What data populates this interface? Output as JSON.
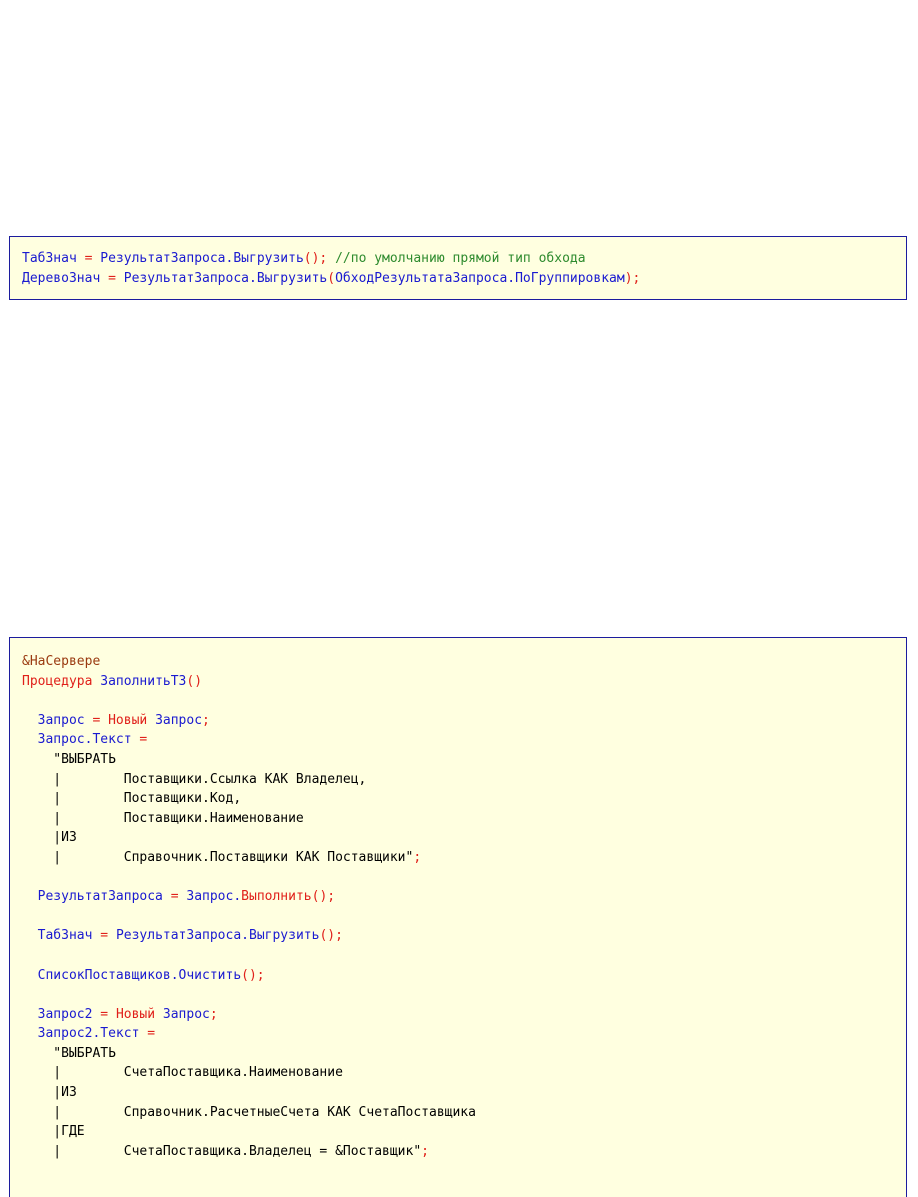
{
  "colors": {
    "identifier": "#1a1ad0",
    "keyword": "#e0201a",
    "operator": "#e0201a",
    "preprocessor": "#9a3a10",
    "comment": "#2e8b2e",
    "string": "#000000",
    "block_background": "#ffffe0",
    "block_border": "#1c1c9e"
  },
  "block1": {
    "lines": [
      [
        {
          "t": "ТабЗнач",
          "c": "id"
        },
        {
          "t": " = ",
          "c": "op"
        },
        {
          "t": "РезультатЗапроса.Выгрузить",
          "c": "id"
        },
        {
          "t": "(); ",
          "c": "op"
        },
        {
          "t": "//по умолчанию прямой тип обхода",
          "c": "cm"
        }
      ],
      [
        {
          "t": "ДеревоЗнач",
          "c": "id"
        },
        {
          "t": " = ",
          "c": "op"
        },
        {
          "t": "РезультатЗапроса.Выгрузить",
          "c": "id"
        },
        {
          "t": "(",
          "c": "op"
        },
        {
          "t": "ОбходРезультатаЗапроса.ПоГруппировкам",
          "c": "id"
        },
        {
          "t": ");",
          "c": "op"
        }
      ]
    ]
  },
  "block2": {
    "lines": [
      [
        {
          "t": "&НаСервере",
          "c": "pp"
        }
      ],
      [
        {
          "t": "Процедура ",
          "c": "kw"
        },
        {
          "t": "ЗаполнитьТЗ",
          "c": "id"
        },
        {
          "t": "()",
          "c": "op"
        }
      ],
      [],
      [
        {
          "t": "  Запрос",
          "c": "id"
        },
        {
          "t": " = ",
          "c": "op"
        },
        {
          "t": "Новый ",
          "c": "kw"
        },
        {
          "t": "Запрос",
          "c": "id"
        },
        {
          "t": ";",
          "c": "op"
        }
      ],
      [
        {
          "t": "  Запрос.Текст",
          "c": "id"
        },
        {
          "t": " =",
          "c": "op"
        }
      ],
      [
        {
          "t": "    \"ВЫБРАТЬ",
          "c": "str"
        }
      ],
      [
        {
          "t": "    |        Поставщики.Ссылка КАК Владелец,",
          "c": "str"
        }
      ],
      [
        {
          "t": "    |        Поставщики.Код,",
          "c": "str"
        }
      ],
      [
        {
          "t": "    |        Поставщики.Наименование",
          "c": "str"
        }
      ],
      [
        {
          "t": "    |ИЗ",
          "c": "str"
        }
      ],
      [
        {
          "t": "    |        Справочник.Поставщики КАК Поставщики\"",
          "c": "str"
        },
        {
          "t": ";",
          "c": "op"
        }
      ],
      [],
      [
        {
          "t": "  РезультатЗапроса",
          "c": "id"
        },
        {
          "t": " = ",
          "c": "op"
        },
        {
          "t": "Запрос.",
          "c": "id"
        },
        {
          "t": "Выполнить",
          "c": "kw"
        },
        {
          "t": "();",
          "c": "op"
        }
      ],
      [],
      [
        {
          "t": "  ТабЗнач",
          "c": "id"
        },
        {
          "t": " = ",
          "c": "op"
        },
        {
          "t": "РезультатЗапроса.Выгрузить",
          "c": "id"
        },
        {
          "t": "();",
          "c": "op"
        }
      ],
      [],
      [
        {
          "t": "  СписокПоставщиков.Очистить",
          "c": "id"
        },
        {
          "t": "();",
          "c": "op"
        }
      ],
      [],
      [
        {
          "t": "  Запрос2",
          "c": "id"
        },
        {
          "t": " = ",
          "c": "op"
        },
        {
          "t": "Новый ",
          "c": "kw"
        },
        {
          "t": "Запрос",
          "c": "id"
        },
        {
          "t": ";",
          "c": "op"
        }
      ],
      [
        {
          "t": "  Запрос2.Текст",
          "c": "id"
        },
        {
          "t": " =",
          "c": "op"
        }
      ],
      [
        {
          "t": "    \"ВЫБРАТЬ",
          "c": "str"
        }
      ],
      [
        {
          "t": "    |        СчетаПоставщика.Наименование",
          "c": "str"
        }
      ],
      [
        {
          "t": "    |ИЗ",
          "c": "str"
        }
      ],
      [
        {
          "t": "    |        Справочник.РасчетныеСчета КАК СчетаПоставщика",
          "c": "str"
        }
      ],
      [
        {
          "t": "    |ГДЕ",
          "c": "str"
        }
      ],
      [
        {
          "t": "    |        СчетаПоставщика.Владелец = &Поставщик\"",
          "c": "str"
        },
        {
          "t": ";",
          "c": "op"
        }
      ]
    ]
  }
}
